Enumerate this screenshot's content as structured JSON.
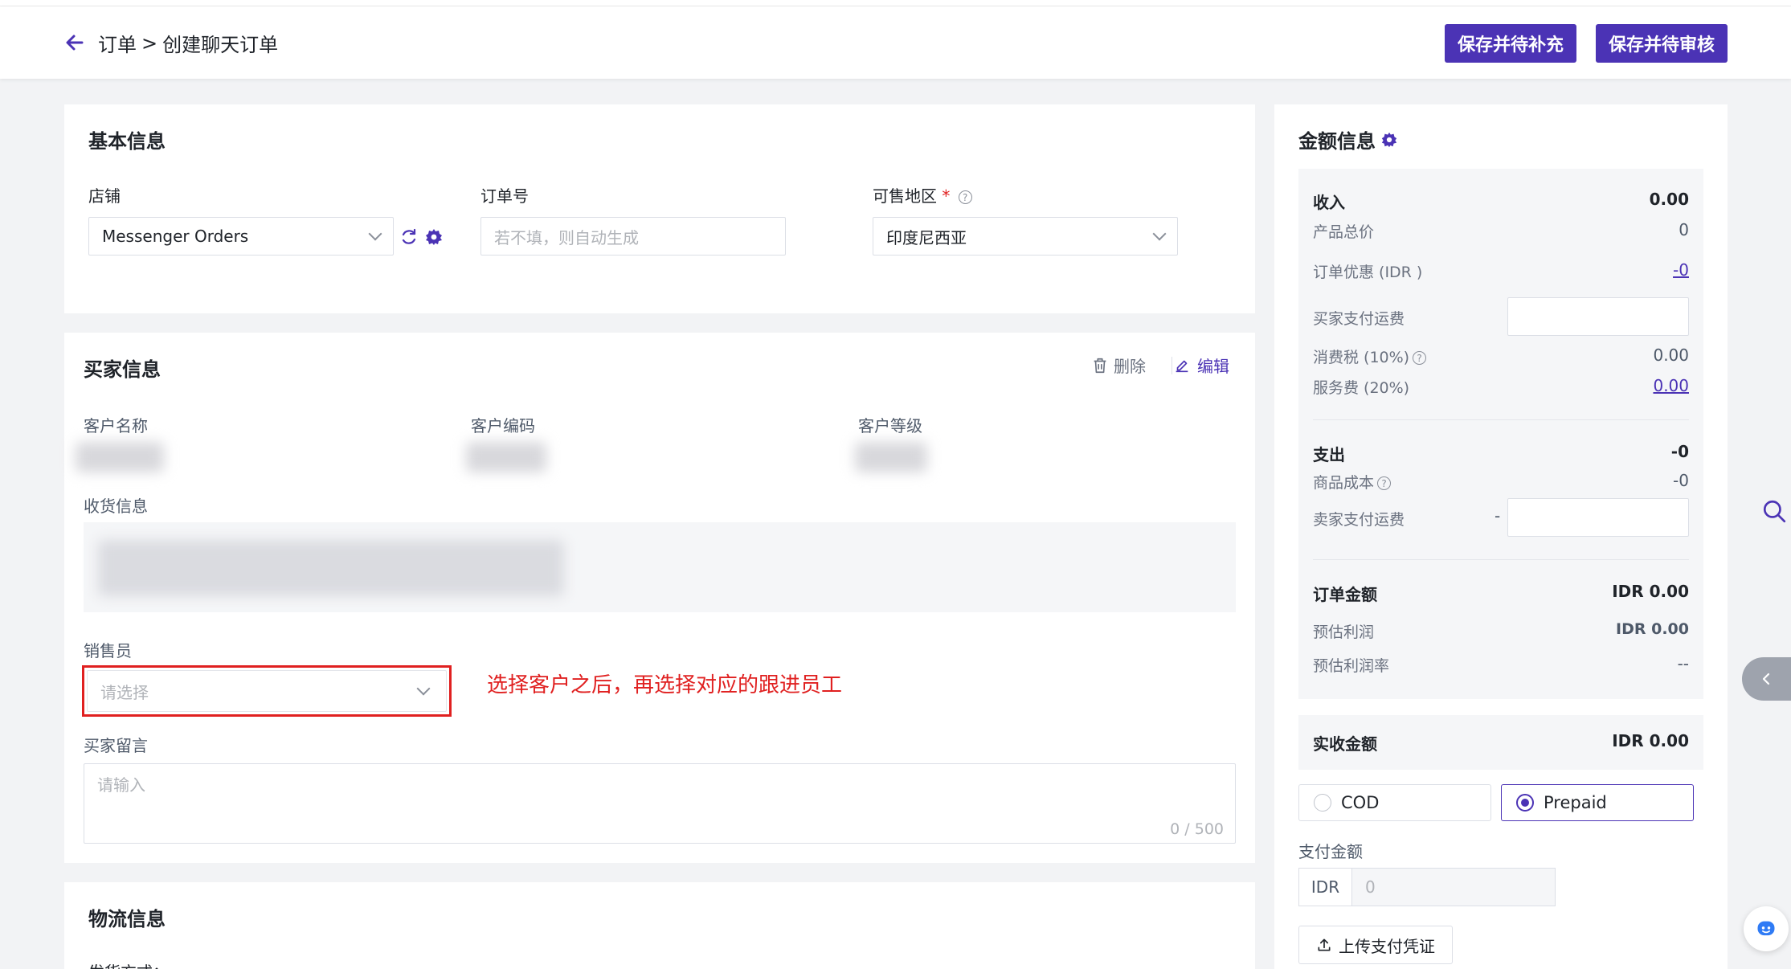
{
  "header": {
    "breadcrumb_root": "订单",
    "breadcrumb_sep": ">",
    "breadcrumb_current": "创建聊天订单",
    "btn_save_supplement": "保存并待补充",
    "btn_save_review": "保存并待审核"
  },
  "basic": {
    "title": "基本信息",
    "store_label": "店铺",
    "store_value": "Messenger Orders",
    "order_no_label": "订单号",
    "order_no_placeholder": "若不填，则自动生成",
    "region_label": "可售地区",
    "region_required": "*",
    "region_value": "印度尼西亚"
  },
  "buyer": {
    "title": "买家信息",
    "delete_label": "删除",
    "edit_label": "编辑",
    "customer_name_label": "客户名称",
    "customer_code_label": "客户编码",
    "customer_level_label": "客户等级",
    "shipping_label": "收货信息",
    "salesperson_label": "销售员",
    "salesperson_placeholder": "请选择",
    "annotation": "选择客户之后，再选择对应的跟进员工",
    "message_label": "买家留言",
    "message_placeholder": "请输入",
    "message_counter": "0 / 500"
  },
  "logistics": {
    "title": "物流信息",
    "shipping_method_label": "发货方式："
  },
  "amount": {
    "title": "金额信息",
    "income_label": "收入",
    "income_value": "0.00",
    "product_total_label": "产品总价",
    "product_total_value": "0",
    "discount_label": "订单优惠 (IDR )",
    "discount_value": "-0",
    "buyer_shipping_label": "买家支付运费",
    "tax_label": "消费税 (10%)",
    "tax_value": "0.00",
    "service_label": "服务费 (20%)",
    "service_value": "0.00",
    "expense_label": "支出",
    "expense_value": "-0",
    "cost_label": "商品成本",
    "cost_value": "-0",
    "seller_shipping_label": "卖家支付运费",
    "seller_shipping_prefix": "-",
    "order_amount_label": "订单金额",
    "order_amount_value": "IDR 0.00",
    "est_profit_label": "预估利润",
    "est_profit_value": "IDR 0.00",
    "est_margin_label": "预估利润率",
    "est_margin_value": "--",
    "received_label": "实收金额",
    "received_value": "IDR 0.00",
    "cod_label": "COD",
    "prepaid_label": "Prepaid",
    "payment_amount_label": "支付金额",
    "currency": "IDR",
    "payment_placeholder": "0",
    "upload_label": "上传支付凭证"
  },
  "colors": {
    "accent": "#4b33b5",
    "annotation_red": "#e02020"
  }
}
